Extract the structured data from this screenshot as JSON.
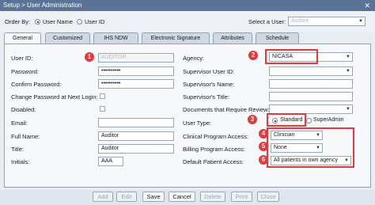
{
  "window": {
    "title": "Setup > User Administration"
  },
  "order_bar": {
    "order_by_label": "Order By:",
    "options": [
      "User Name",
      "User ID"
    ],
    "selected_option": "User Name",
    "select_user_label": "Select a User:",
    "select_user_value": "Auditor"
  },
  "tabs": [
    "General",
    "Customized",
    "IHS NDW",
    "Electronic Signature",
    "Attributes",
    "Schedule"
  ],
  "active_tab": "General",
  "left_form": {
    "user_id_label": "User ID:",
    "user_id_value": "AUDITOR",
    "password_label": "Password:",
    "password_value": "••••••••••",
    "confirm_password_label": "Confirm Password:",
    "confirm_password_value": "••••••••••",
    "change_password_label": "Change Password at Next Login:",
    "disabled_label": "Disabled:",
    "email_label": "Email:",
    "email_value": "",
    "full_name_label": "Full Name:",
    "full_name_value": "Auditor",
    "title_label": "Title:",
    "title_value": "Auditor",
    "initials_label": "Initials:",
    "initials_value": "AAA"
  },
  "right_form": {
    "agency_label": "Agency:",
    "agency_value": "NICASA",
    "supervisor_user_id_label": "Supervisor User ID:",
    "supervisor_name_label": "Supervisor's Name:",
    "supervisor_title_label": "Supervisor's Title:",
    "documents_review_label": "Documents that Require Review:",
    "user_type_label": "User Type:",
    "user_type_options": [
      "Standard",
      "SuperAdmin"
    ],
    "user_type_selected": "Standard",
    "clinical_access_label": "Clinical Program Access:",
    "clinical_access_value": "Clinician",
    "billing_access_label": "Billing Program Access:",
    "billing_access_value": "None",
    "default_patient_access_label": "Default Patient Access:",
    "default_patient_access_value": "All patients in own agency"
  },
  "callouts": [
    "1",
    "2",
    "3",
    "4",
    "5",
    "6"
  ],
  "buttons": [
    "Add",
    "Edit",
    "Save",
    "Cancel",
    "Delete",
    "Print",
    "Close"
  ],
  "colors": {
    "callout": "#e03a3a",
    "titlebar": "#5a7396"
  }
}
